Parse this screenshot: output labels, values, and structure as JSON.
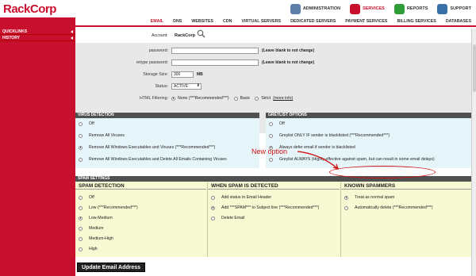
{
  "brand": {
    "name_rack": "Rack",
    "name_corp": "Corp"
  },
  "top_links": [
    {
      "label": "ADMINISTRATION",
      "icon": "admin-icon",
      "color": "#5d7fa8"
    },
    {
      "label": "SERVICES",
      "icon": "services-icon",
      "color": "#c8102e",
      "active": true
    },
    {
      "label": "REPORTS",
      "icon": "reports-icon",
      "color": "#2f9c3a"
    },
    {
      "label": "SUPPORT",
      "icon": "support-icon",
      "color": "#3b6fa8"
    }
  ],
  "nav": [
    "EMAIL",
    "DNS",
    "WEBSITES",
    "CDN",
    "VIRTUAL SERVERS",
    "DEDICATED SERVERS",
    "PAYMENT SERVICES",
    "BILLING SERVICES",
    "DATABASES"
  ],
  "sidebar": {
    "items": [
      {
        "label": "QUICKLINKS"
      },
      {
        "label": "HISTORY"
      }
    ]
  },
  "account": {
    "label": "Account:",
    "value": "RackCorp"
  },
  "form": {
    "password_label": "password:",
    "password_note": "(Leave blank to not change)",
    "retype_label": "retype password:",
    "retype_note": "(Leave blank to not change)",
    "storage_label": "Storage Size:",
    "storage_value": "300",
    "storage_unit": "MB",
    "status_label": "Status:",
    "status_value": "ACTIVE",
    "html_label": "HTML Filtering:",
    "html_options": [
      "None (***Recommended***)",
      "Basic",
      "Strict"
    ],
    "html_more": "(more info)"
  },
  "virus": {
    "title": "VIRUS DETECTION",
    "options": [
      "Off",
      "Remove All Viruses",
      "Remove All Windows Executables and Viruses (***Recommended***)",
      "Remove All Windows Executables and Delete All Emails Containing Viruses"
    ],
    "selected": 2
  },
  "greylist": {
    "title": "GREYLIST OPTIONS",
    "options": [
      "Off",
      "Greylist ONLY IF sender is blacklisted (***Recommended***)",
      "Always defer email if sender is blacklisted",
      "Greylist ALWAYS (Highly effective against spam, but can result in some email delays)"
    ],
    "selected": 2
  },
  "annotation": {
    "text": "New option"
  },
  "spam": {
    "title": "SPAM SETTINGS",
    "detection": {
      "title": "SPAM DETECTION",
      "options": [
        "Off",
        "Low (***Recommended***)",
        "Low-Medium",
        "Medium",
        "Medium-High",
        "High"
      ],
      "selected": 2
    },
    "when": {
      "title": "WHEN SPAM IS DETECTED",
      "options": [
        "Add status to Email Header",
        "Add ***SPAM*** to Subject line (***Recommended***)",
        "Delete Email"
      ],
      "selected": 1
    },
    "known": {
      "title": "KNOWN SPAMMERS",
      "options": [
        "Treat as normal spam",
        "Automatically delete (***Recommended***)"
      ],
      "selected": 0
    }
  },
  "update_button": "Update Email Address"
}
